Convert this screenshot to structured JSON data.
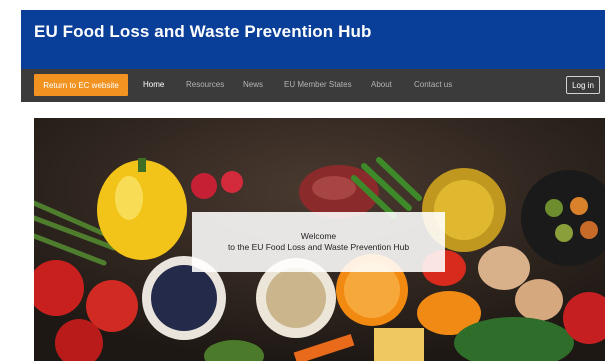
{
  "header": {
    "title": "EU Food Loss and Waste Prevention Hub"
  },
  "nav": {
    "return_label": "Return to EC website",
    "links": [
      "Home",
      "Resources",
      "News",
      "EU Member States",
      "About",
      "Contact us"
    ],
    "login_label": "Log in"
  },
  "hero": {
    "welcome_line1": "Welcome",
    "welcome_line2": "to the EU Food Loss and Waste Prevention Hub"
  },
  "colors": {
    "header_bg": "#0a3f99",
    "nav_bg": "#3b3b3b",
    "accent": "#f29220"
  }
}
